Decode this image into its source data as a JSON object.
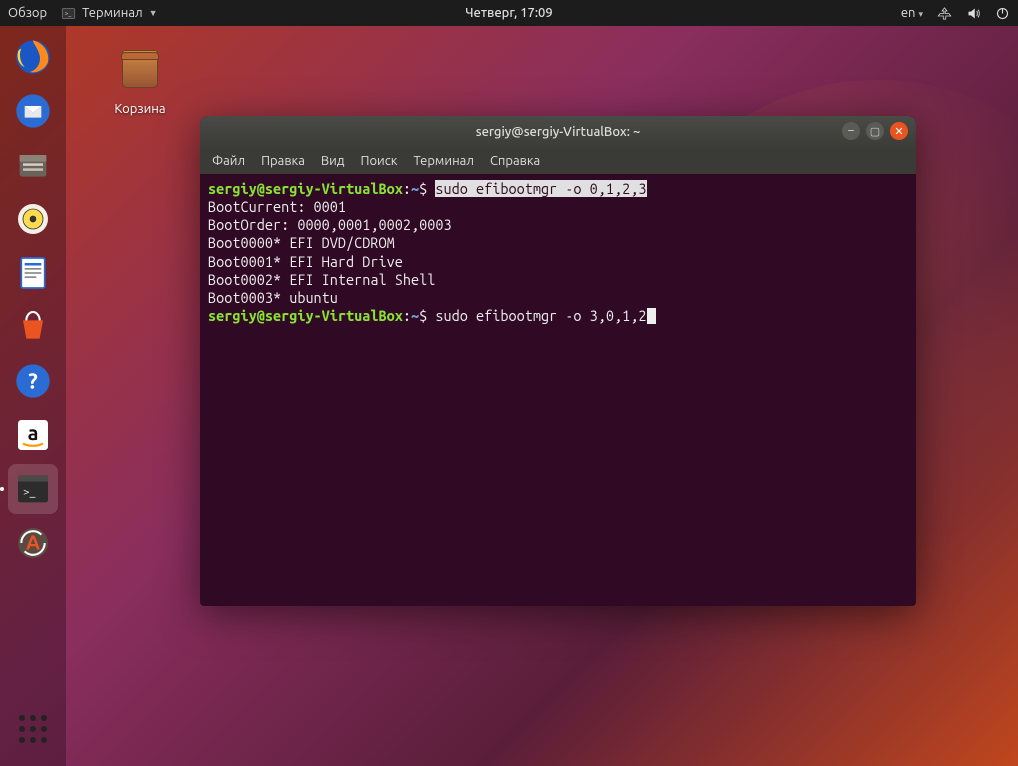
{
  "topbar": {
    "activities": "Обзор",
    "app_name": "Терминал",
    "clock": "Четверг, 17:09",
    "lang": "en"
  },
  "desktop": {
    "trash_label": "Корзина"
  },
  "launcher": {
    "items": [
      {
        "name": "firefox"
      },
      {
        "name": "thunderbird"
      },
      {
        "name": "files"
      },
      {
        "name": "rhythmbox"
      },
      {
        "name": "writer"
      },
      {
        "name": "software"
      },
      {
        "name": "help"
      },
      {
        "name": "amazon"
      },
      {
        "name": "terminal"
      },
      {
        "name": "updater"
      }
    ]
  },
  "terminal": {
    "title": "sergiy@sergiy-VirtualBox: ~",
    "menu": [
      "Файл",
      "Правка",
      "Вид",
      "Поиск",
      "Терминал",
      "Справка"
    ],
    "prompt_user": "sergiy@sergiy-VirtualBox",
    "prompt_path": "~",
    "cmd1": "sudo efibootmgr -o 0,1,2,3",
    "out": [
      "BootCurrent: 0001",
      "BootOrder: 0000,0001,0002,0003",
      "Boot0000* EFI DVD/CDROM",
      "Boot0001* EFI Hard Drive",
      "Boot0002* EFI Internal Shell",
      "Boot0003* ubuntu"
    ],
    "cmd2": "sudo efibootmgr -o 3,0,1,2"
  }
}
